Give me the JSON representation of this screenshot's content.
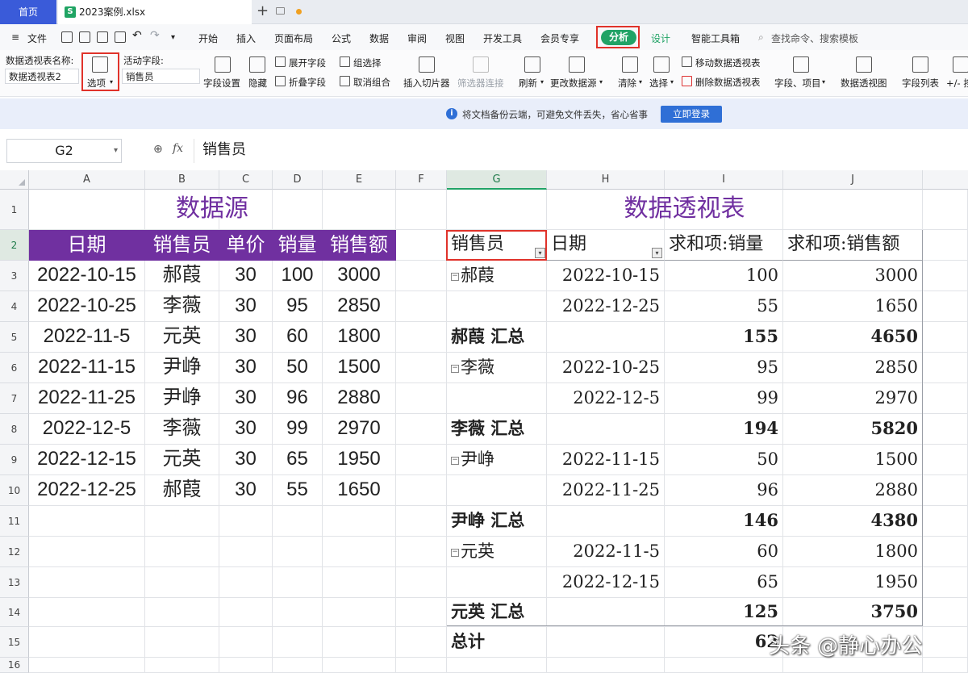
{
  "tabs": {
    "home": "首页",
    "file": "2023案例.xlsx"
  },
  "menu": {
    "file": "文件",
    "items": [
      "开始",
      "插入",
      "页面布局",
      "公式",
      "数据",
      "审阅",
      "视图",
      "开发工具",
      "会员专享",
      "分析",
      "设计",
      "智能工具箱"
    ],
    "search": "查找命令、搜索模板"
  },
  "ribbon": {
    "pivot_name_label": "数据透视表名称:",
    "pivot_name": "数据透视表2",
    "options": "选项",
    "active_field_label": "活动字段:",
    "active_field": "销售员",
    "field_settings": "字段设置",
    "hide": "隐藏",
    "expand_field": "展开字段",
    "collapse_field": "折叠字段",
    "group_selection": "组选择",
    "ungroup": "取消组合",
    "insert_slicer": "插入切片器",
    "filter_connections": "筛选器连接",
    "refresh": "刷新",
    "change_source": "更改数据源",
    "clear": "清除",
    "select": "选择",
    "move_pivot": "移动数据透视表",
    "delete_pivot": "删除数据透视表",
    "fields_items": "字段、项目",
    "pivot_chart": "数据透视图",
    "field_list": "字段列表",
    "plus_minus": "+/- 按"
  },
  "notice": {
    "message": "将文档备份云端，可避免文件丢失，省心省事",
    "login": "立即登录"
  },
  "formula": {
    "cell": "G2",
    "fx": "fx",
    "value": "销售员"
  },
  "columns": [
    "A",
    "B",
    "C",
    "D",
    "E",
    "F",
    "G",
    "H",
    "I",
    "J"
  ],
  "rows": [
    "1",
    "2",
    "3",
    "4",
    "5",
    "6",
    "7",
    "8",
    "9",
    "10",
    "11",
    "12",
    "13",
    "14",
    "15",
    "16"
  ],
  "source": {
    "title": "数据源",
    "headers": [
      "日期",
      "销售员",
      "单价",
      "销量",
      "销售额"
    ],
    "rows": [
      [
        "2022-10-15",
        "郝葭",
        "30",
        "100",
        "3000"
      ],
      [
        "2022-10-25",
        "李薇",
        "30",
        "95",
        "2850"
      ],
      [
        "2022-11-5",
        "元英",
        "30",
        "60",
        "1800"
      ],
      [
        "2022-11-15",
        "尹峥",
        "30",
        "50",
        "1500"
      ],
      [
        "2022-11-25",
        "尹峥",
        "30",
        "96",
        "2880"
      ],
      [
        "2022-12-5",
        "李薇",
        "30",
        "99",
        "2970"
      ],
      [
        "2022-12-15",
        "元英",
        "30",
        "65",
        "1950"
      ],
      [
        "2022-12-25",
        "郝葭",
        "30",
        "55",
        "1650"
      ]
    ]
  },
  "pivot": {
    "title": "数据透视表",
    "headers": [
      "销售员",
      "日期",
      "求和项:销量",
      "求和项:销售额"
    ],
    "rows": [
      {
        "name": "郝葭",
        "expand": true,
        "date": "2022-10-15",
        "qty": "100",
        "amt": "3000",
        "bold": false
      },
      {
        "name": "",
        "expand": false,
        "date": "2022-12-25",
        "qty": "55",
        "amt": "1650",
        "bold": false
      },
      {
        "name": "郝葭 汇总",
        "expand": false,
        "date": "",
        "qty": "155",
        "amt": "4650",
        "bold": true
      },
      {
        "name": "李薇",
        "expand": true,
        "date": "2022-10-25",
        "qty": "95",
        "amt": "2850",
        "bold": false
      },
      {
        "name": "",
        "expand": false,
        "date": "2022-12-5",
        "qty": "99",
        "amt": "2970",
        "bold": false
      },
      {
        "name": "李薇 汇总",
        "expand": false,
        "date": "",
        "qty": "194",
        "amt": "5820",
        "bold": true
      },
      {
        "name": "尹峥",
        "expand": true,
        "date": "2022-11-15",
        "qty": "50",
        "amt": "1500",
        "bold": false
      },
      {
        "name": "",
        "expand": false,
        "date": "2022-11-25",
        "qty": "96",
        "amt": "2880",
        "bold": false
      },
      {
        "name": "尹峥 汇总",
        "expand": false,
        "date": "",
        "qty": "146",
        "amt": "4380",
        "bold": true
      },
      {
        "name": "元英",
        "expand": true,
        "date": "2022-11-5",
        "qty": "60",
        "amt": "1800",
        "bold": false
      },
      {
        "name": "",
        "expand": false,
        "date": "2022-12-15",
        "qty": "65",
        "amt": "1950",
        "bold": false
      },
      {
        "name": "元英 汇总",
        "expand": false,
        "date": "",
        "qty": "125",
        "amt": "3750",
        "bold": true
      }
    ],
    "total_label": "总计",
    "total_qty": "62"
  },
  "watermark": "头条 @静心办公",
  "colors": {
    "accent_purple": "#7030a0",
    "wps_green": "#21a366",
    "highlight_red": "#e0322a",
    "tab_blue": "#3a5bd9"
  }
}
